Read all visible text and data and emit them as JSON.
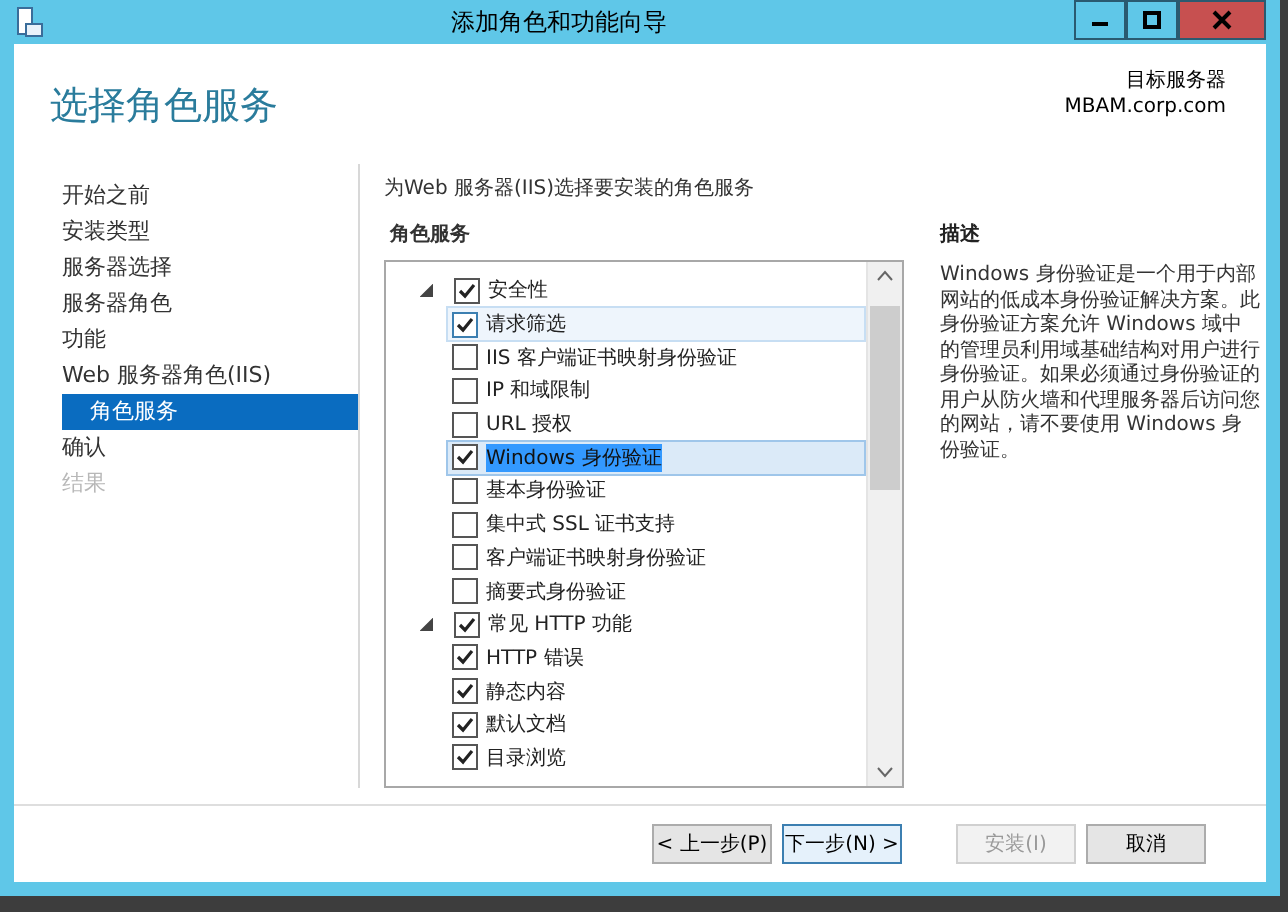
{
  "window": {
    "title": "添加角色和功能向导"
  },
  "header": {
    "title": "选择角色服务",
    "target_label": "目标服务器",
    "target_server": "MBAM.corp.com"
  },
  "sidebar": {
    "items": [
      {
        "label": "开始之前",
        "selected": false,
        "disabled": false
      },
      {
        "label": "安装类型",
        "selected": false,
        "disabled": false
      },
      {
        "label": "服务器选择",
        "selected": false,
        "disabled": false
      },
      {
        "label": "服务器角色",
        "selected": false,
        "disabled": false
      },
      {
        "label": "功能",
        "selected": false,
        "disabled": false
      },
      {
        "label": "Web 服务器角色(IIS)",
        "selected": false,
        "disabled": false,
        "children": [
          {
            "label": "角色服务",
            "selected": true,
            "disabled": false
          }
        ]
      },
      {
        "label": "确认",
        "selected": false,
        "disabled": false
      },
      {
        "label": "结果",
        "selected": false,
        "disabled": true
      }
    ]
  },
  "main": {
    "instruction": "为Web 服务器(IIS)选择要安装的角色服务",
    "list_heading": "角色服务",
    "tree": [
      {
        "label": "安全性",
        "checked": true,
        "expanded": true,
        "selected": false,
        "hovered": false,
        "children": [
          {
            "label": "请求筛选",
            "checked": true,
            "selected": false,
            "hovered": true
          },
          {
            "label": "IIS 客户端证书映射身份验证",
            "checked": false,
            "selected": false,
            "hovered": false
          },
          {
            "label": "IP 和域限制",
            "checked": false,
            "selected": false,
            "hovered": false
          },
          {
            "label": "URL 授权",
            "checked": false,
            "selected": false,
            "hovered": false
          },
          {
            "label": "Windows 身份验证",
            "checked": true,
            "selected": true,
            "hovered": false
          },
          {
            "label": "基本身份验证",
            "checked": false,
            "selected": false,
            "hovered": false
          },
          {
            "label": "集中式 SSL 证书支持",
            "checked": false,
            "selected": false,
            "hovered": false
          },
          {
            "label": "客户端证书映射身份验证",
            "checked": false,
            "selected": false,
            "hovered": false
          },
          {
            "label": "摘要式身份验证",
            "checked": false,
            "selected": false,
            "hovered": false
          }
        ]
      },
      {
        "label": "常见 HTTP 功能",
        "checked": true,
        "expanded": true,
        "selected": false,
        "hovered": false,
        "children": [
          {
            "label": "HTTP 错误",
            "checked": true,
            "selected": false,
            "hovered": false
          },
          {
            "label": "静态内容",
            "checked": true,
            "selected": false,
            "hovered": false
          },
          {
            "label": "默认文档",
            "checked": true,
            "selected": false,
            "hovered": false
          },
          {
            "label": "目录浏览",
            "checked": true,
            "selected": false,
            "hovered": false
          }
        ]
      }
    ]
  },
  "description": {
    "heading": "描述",
    "text": "Windows 身份验证是一个用于内部网站的低成本身份验证解决方案。此身份验证方案允许 Windows 域中的管理员利用域基础结构对用户进行身份验证。如果必须通过身份验证的用户从防火墙和代理服务器后访问您的网站，请不要使用 Windows 身份验证。"
  },
  "buttons": [
    {
      "label": "< 上一步(P)",
      "disabled": false,
      "focused": false
    },
    {
      "label": "下一步(N) >",
      "disabled": false,
      "focused": true
    },
    {
      "label": "安装(I)",
      "disabled": true,
      "focused": false
    },
    {
      "label": "取消",
      "disabled": false,
      "focused": false
    }
  ]
}
